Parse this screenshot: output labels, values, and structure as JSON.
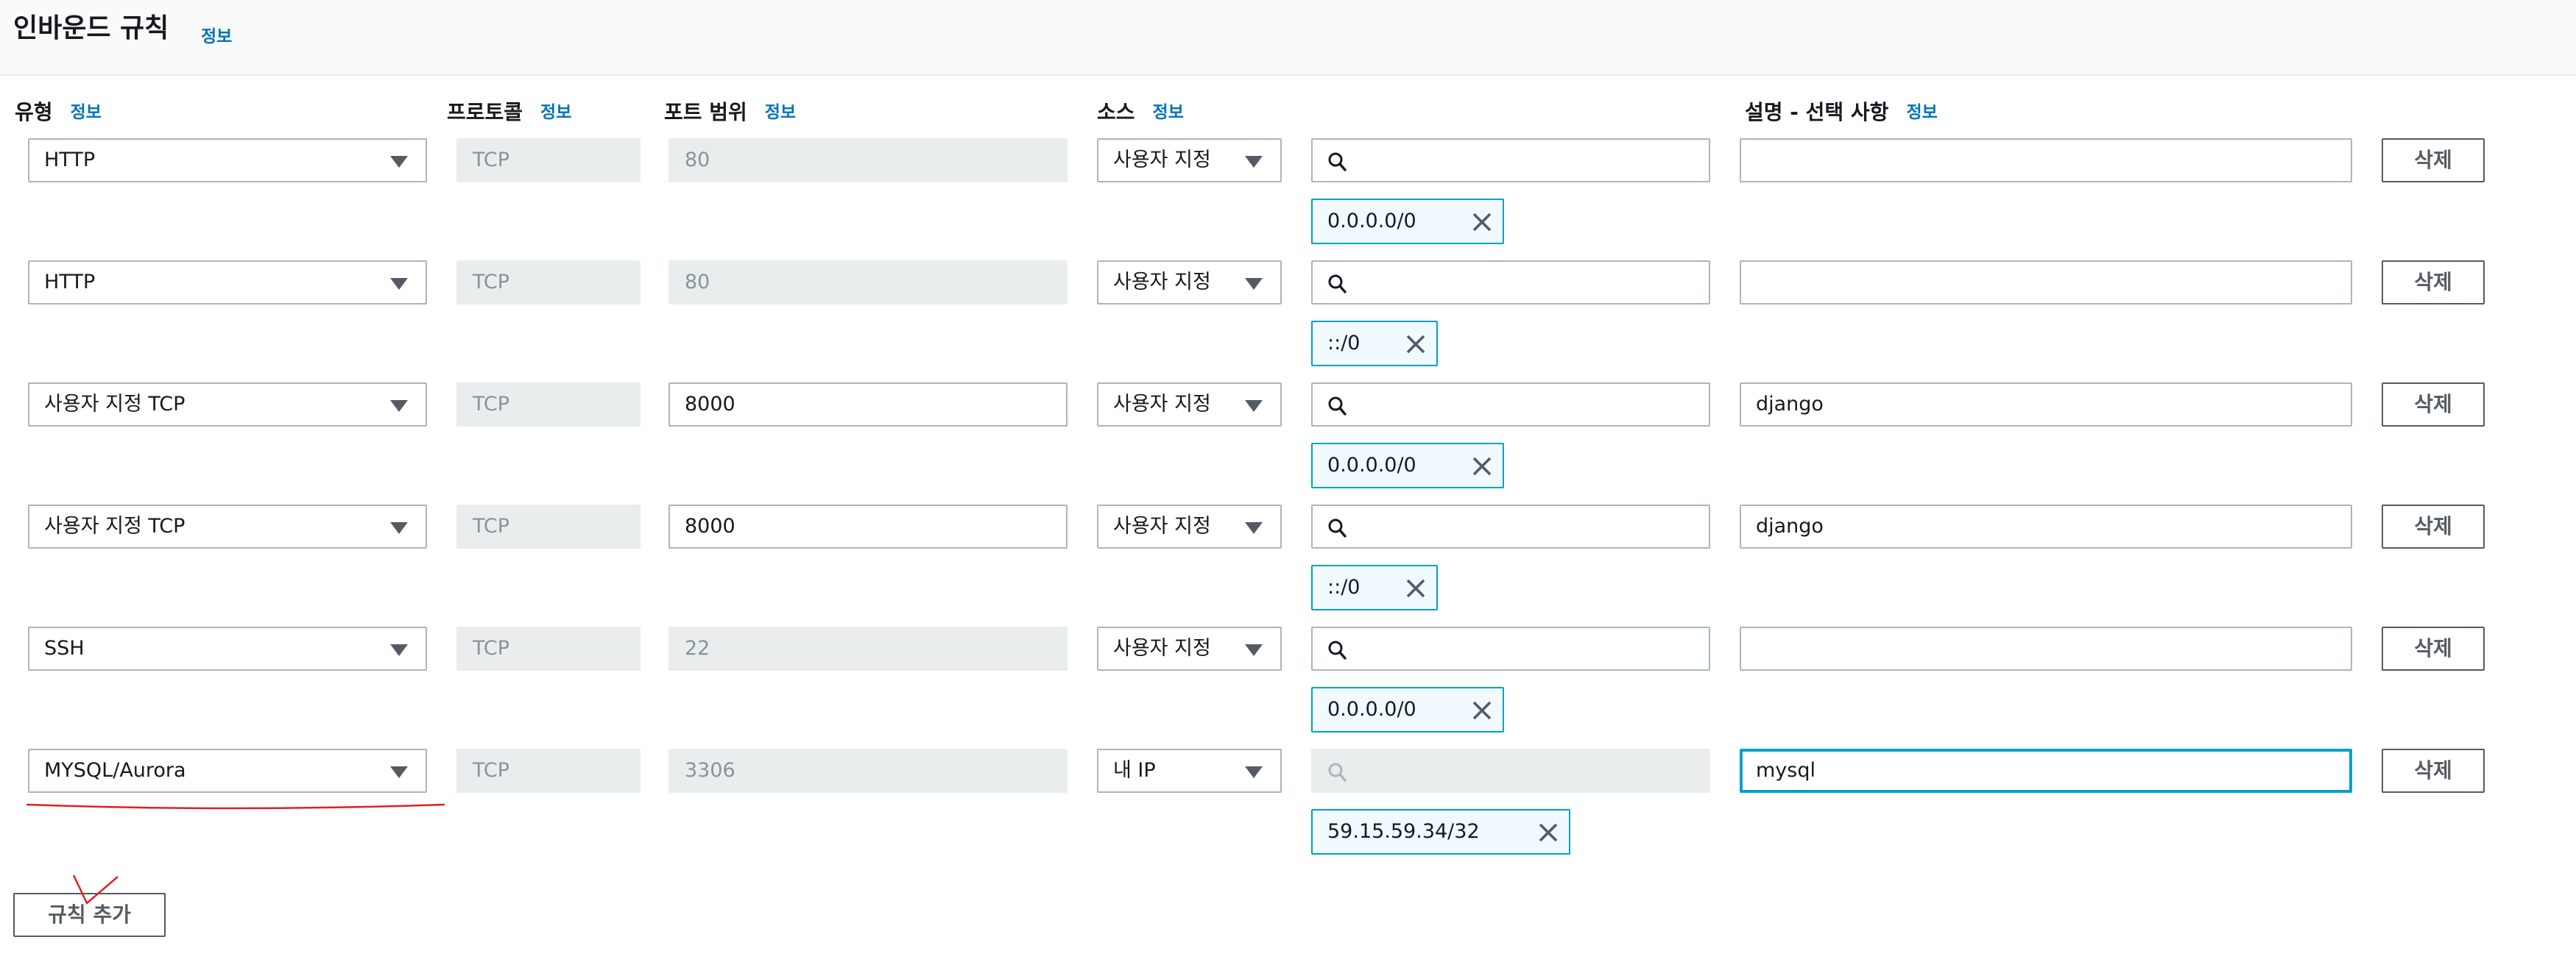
{
  "section": {
    "title": "인바운드 규칙",
    "info_label": "정보"
  },
  "columns": {
    "type": {
      "label": "유형",
      "info": "정보"
    },
    "protocol": {
      "label": "프로토콜",
      "info": "정보"
    },
    "port_range": {
      "label": "포트 범위",
      "info": "정보"
    },
    "source": {
      "label": "소스",
      "info": "정보"
    },
    "description": {
      "label": "설명 - 선택 사항",
      "info": "정보"
    }
  },
  "rules": [
    {
      "type": "HTTP",
      "protocol": "TCP",
      "port": "80",
      "port_editable": false,
      "source_type": "사용자 지정",
      "search_disabled": false,
      "cidr": "0.0.0.0/0",
      "description": "",
      "delete_label": "삭제"
    },
    {
      "type": "HTTP",
      "protocol": "TCP",
      "port": "80",
      "port_editable": false,
      "source_type": "사용자 지정",
      "search_disabled": false,
      "cidr": "::/0",
      "description": "",
      "delete_label": "삭제"
    },
    {
      "type": "사용자 지정 TCP",
      "protocol": "TCP",
      "port": "8000",
      "port_editable": true,
      "source_type": "사용자 지정",
      "search_disabled": false,
      "cidr": "0.0.0.0/0",
      "description": "django",
      "delete_label": "삭제"
    },
    {
      "type": "사용자 지정 TCP",
      "protocol": "TCP",
      "port": "8000",
      "port_editable": true,
      "source_type": "사용자 지정",
      "search_disabled": false,
      "cidr": "::/0",
      "description": "django",
      "delete_label": "삭제"
    },
    {
      "type": "SSH",
      "protocol": "TCP",
      "port": "22",
      "port_editable": false,
      "source_type": "사용자 지정",
      "search_disabled": false,
      "cidr": "0.0.0.0/0",
      "description": "",
      "delete_label": "삭제"
    },
    {
      "type": "MYSQL/Aurora",
      "protocol": "TCP",
      "port": "3306",
      "port_editable": false,
      "source_type": "내 IP",
      "search_disabled": true,
      "cidr": "59.15.59.34/32",
      "description": "mysql",
      "delete_label": "삭제",
      "focused": true
    }
  ],
  "actions": {
    "add_rule_label": "규칙 추가"
  },
  "colors": {
    "link": "#0073bb",
    "token_border": "#00a1c9",
    "token_bg": "#f1faff",
    "disabled_bg": "#eaeded",
    "annotation": "#e02020"
  },
  "icons": {
    "dropdown": "caret-down-icon",
    "search": "search-icon",
    "remove_token": "close-icon"
  }
}
